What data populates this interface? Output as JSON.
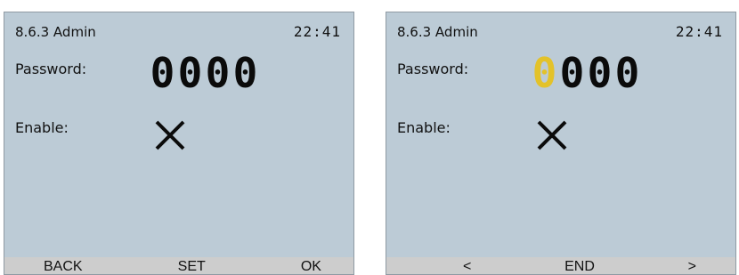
{
  "screens": [
    {
      "title": "8.6.3 Admin",
      "clock": "22:41",
      "password_label": "Password:",
      "password_digits": [
        "0",
        "0",
        "0",
        "0"
      ],
      "enable_label": "Enable:",
      "enable_icon": "cross-icon",
      "softkeys": [
        "BACK",
        "SET",
        "OK"
      ]
    },
    {
      "title": "8.6.3 Admin",
      "clock": "22:41",
      "password_label": "Password:",
      "password_digits": [
        "0",
        "0",
        "0",
        "0"
      ],
      "active_digit_index": 0,
      "enable_label": "Enable:",
      "enable_icon": "cross-icon",
      "softkeys": [
        "<",
        "END",
        ">"
      ]
    }
  ],
  "colors": {
    "screen_background": "#bccbd6",
    "softkey_bar": "#cdcdcd",
    "digit_cursor": "#e3c22a"
  }
}
